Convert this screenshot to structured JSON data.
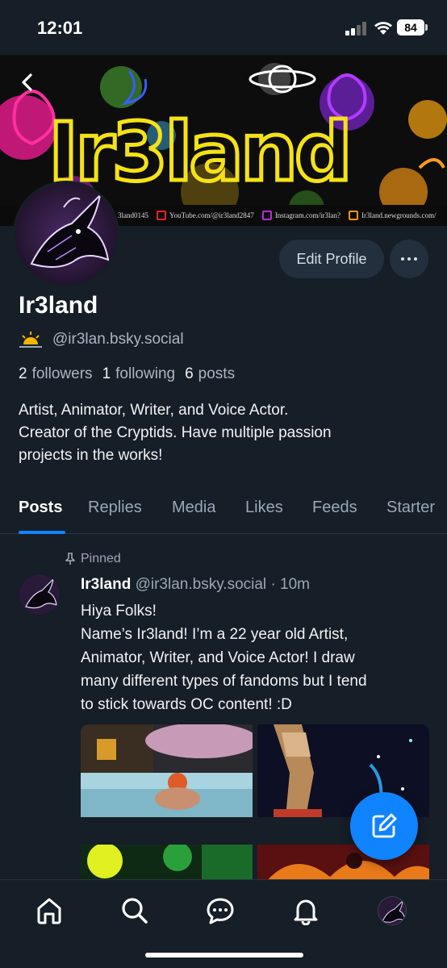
{
  "status_bar": {
    "time": "12:01",
    "battery": "84"
  },
  "banner": {
    "title_art": "Ir3land",
    "links": [
      "3land0145",
      "YouTube.com/@ir3land2847",
      "Instagram.com/ir3lan?",
      "Ir3land.newgrounds.com/"
    ]
  },
  "profile": {
    "edit_label": "Edit Profile",
    "display_name": "Ir3land",
    "handle": "@ir3lan.bsky.social",
    "followers_count": "2",
    "followers_label": "followers",
    "following_count": "1",
    "following_label": "following",
    "posts_count": "6",
    "posts_label": "posts",
    "bio_lines": [
      "Artist, Animator, Writer, and Voice Actor.",
      "Creator of the Cryptids. Have multiple passion",
      "projects in the works!"
    ]
  },
  "tabs": [
    "Posts",
    "Replies",
    "Media",
    "Likes",
    "Feeds",
    "Starter"
  ],
  "post": {
    "pinned_label": "Pinned",
    "author": "Ir3land",
    "handle": "@ir3lan.bsky.social",
    "separator": "·",
    "time": "10m",
    "text_lines": [
      "Hiya Folks!",
      "Name’s Ir3land! I’m a 22 year old Artist,",
      "Animator, Writer, and Voice Actor! I draw",
      "many different types of fandoms but I tend",
      "to stick towards OC content! :D"
    ]
  },
  "icons": {
    "back": "chevron-left-icon",
    "more": "ellipsis-icon",
    "pin": "pin-icon",
    "compose": "compose-icon",
    "nav": [
      "home-icon",
      "search-icon",
      "chat-icon",
      "bell-icon",
      "profile-avatar"
    ]
  },
  "colors": {
    "background": "#161e27",
    "accent": "#1083fe",
    "muted": "#9aa8b6",
    "button": "#232f3c"
  }
}
